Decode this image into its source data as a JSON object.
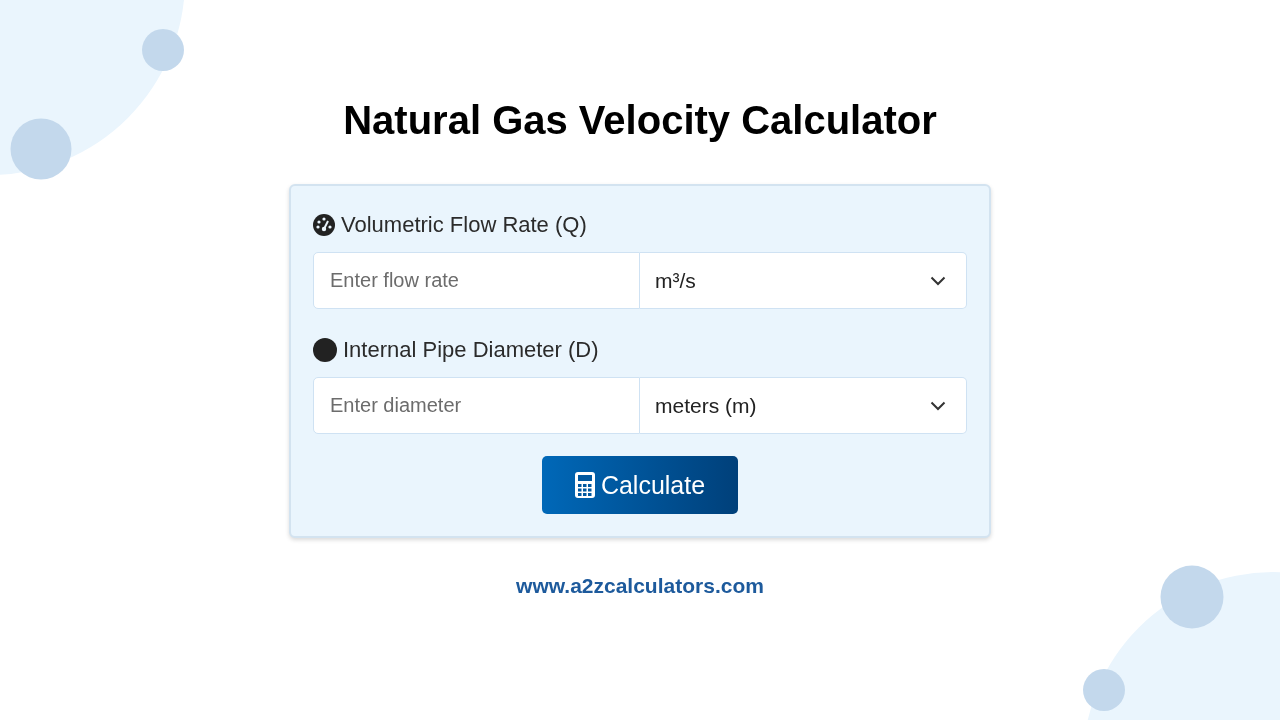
{
  "title": "Natural Gas Velocity Calculator",
  "fields": [
    {
      "kind": "gauge",
      "label": "Volumetric Flow Rate (Q)",
      "placeholder": "Enter flow rate",
      "unit": "m³/s"
    },
    {
      "kind": "circle",
      "label": "Internal Pipe Diameter (D)",
      "placeholder": "Enter diameter",
      "unit": "meters (m)"
    }
  ],
  "button": "Calculate",
  "footer_link": "www.a2zcalculators.com"
}
